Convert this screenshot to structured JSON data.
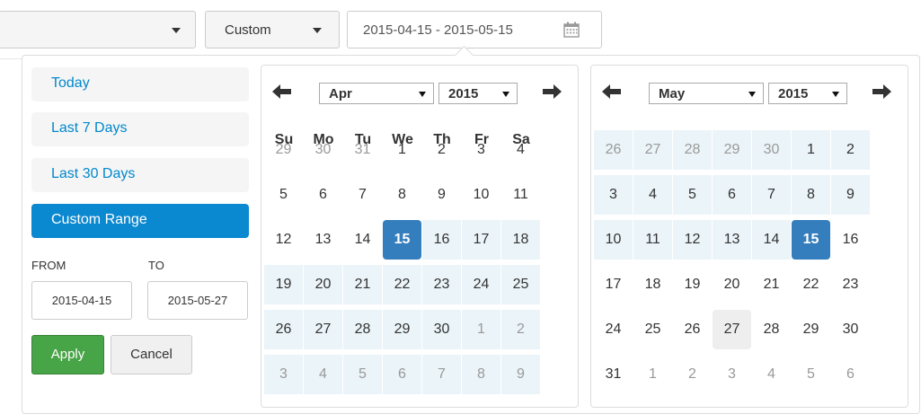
{
  "toolbar": {
    "custom_dropdown_label": "Custom",
    "date_range_value": "2015-04-15 - 2015-05-15"
  },
  "ranges": {
    "items": [
      {
        "label": "Today"
      },
      {
        "label": "Last 7 Days"
      },
      {
        "label": "Last 30 Days"
      },
      {
        "label": "Custom Range"
      }
    ],
    "from_label": "FROM",
    "to_label": "TO",
    "from_value": "2015-04-15",
    "to_value": "2015-05-27",
    "apply_label": "Apply",
    "cancel_label": "Cancel"
  },
  "weekdays": [
    "Su",
    "Mo",
    "Tu",
    "We",
    "Th",
    "Fr",
    "Sa"
  ],
  "calendars": [
    {
      "month": "Apr",
      "year": "2015",
      "days": [
        [
          "29",
          "30",
          "31",
          "1",
          "2",
          "3",
          "4"
        ],
        [
          "5",
          "6",
          "7",
          "8",
          "9",
          "10",
          "11"
        ],
        [
          "12",
          "13",
          "14",
          "15",
          "16",
          "17",
          "18"
        ],
        [
          "19",
          "20",
          "21",
          "22",
          "23",
          "24",
          "25"
        ],
        [
          "26",
          "27",
          "28",
          "29",
          "30",
          "1",
          "2"
        ],
        [
          "3",
          "4",
          "5",
          "6",
          "7",
          "8",
          "9"
        ]
      ]
    },
    {
      "month": "May",
      "year": "2015",
      "days": [
        [
          "26",
          "27",
          "28",
          "29",
          "30",
          "1",
          "2"
        ],
        [
          "3",
          "4",
          "5",
          "6",
          "7",
          "8",
          "9"
        ],
        [
          "10",
          "11",
          "12",
          "13",
          "14",
          "15",
          "16"
        ],
        [
          "17",
          "18",
          "19",
          "20",
          "21",
          "22",
          "23"
        ],
        [
          "24",
          "25",
          "26",
          "27",
          "28",
          "29",
          "30"
        ],
        [
          "31",
          "1",
          "2",
          "3",
          "4",
          "5",
          "6"
        ]
      ]
    }
  ],
  "colors": {
    "accent": "#0a88d0",
    "selected_day": "#357ebd",
    "in_range": "#ebf4f8",
    "apply": "#47a447",
    "link": "#0088cc"
  },
  "icons": [
    "calendar-icon",
    "arrow-left-icon",
    "arrow-right-icon",
    "chevron-down-icon"
  ]
}
